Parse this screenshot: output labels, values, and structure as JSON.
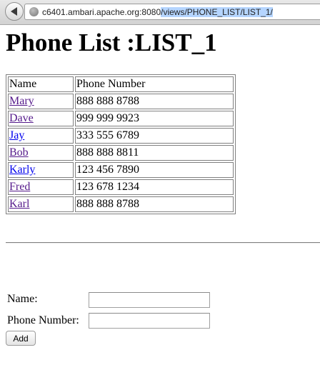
{
  "browser": {
    "url_prefix": "c6401.ambari.apache.org:8080",
    "url_path": "/views/PHONE_LIST/LIST_1/"
  },
  "page": {
    "title": "Phone List :LIST_1"
  },
  "table": {
    "headers": [
      "Name",
      "Phone Number"
    ],
    "rows": [
      {
        "name": "Mary",
        "phone": "888 888 8788",
        "visited": true
      },
      {
        "name": "Dave",
        "phone": "999 999 9923",
        "visited": true
      },
      {
        "name": "Jay",
        "phone": "333 555 6789",
        "visited": false
      },
      {
        "name": "Bob",
        "phone": "888 888 8811",
        "visited": true
      },
      {
        "name": "Karly",
        "phone": "123 456 7890",
        "visited": false
      },
      {
        "name": "Fred",
        "phone": "123 678 1234",
        "visited": true
      },
      {
        "name": "Karl",
        "phone": "888 888 8788",
        "visited": true
      }
    ]
  },
  "form": {
    "name_label": "Name:",
    "phone_label": "Phone Number:",
    "name_value": "",
    "phone_value": "",
    "add_label": "Add"
  }
}
